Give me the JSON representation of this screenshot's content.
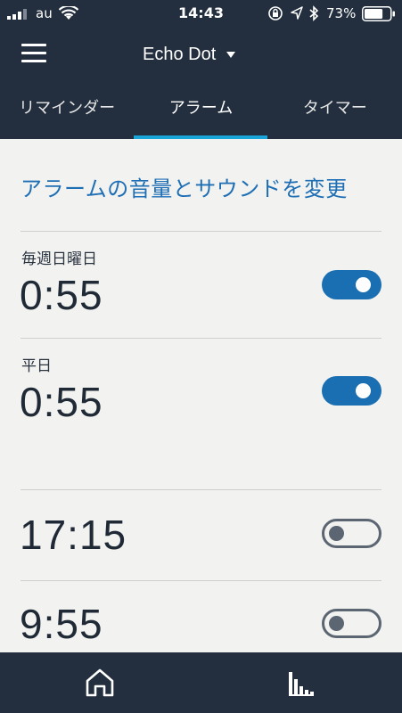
{
  "status_bar": {
    "carrier": "au",
    "time": "14:43",
    "battery_percent": "73%",
    "battery_level": 0.73,
    "icons": [
      "signal-icon",
      "wifi-icon",
      "rotation-lock-icon",
      "location-icon",
      "bluetooth-icon",
      "battery-icon"
    ]
  },
  "header": {
    "menu_icon": "hamburger-menu-icon",
    "device_name": "Echo Dot",
    "caret_icon": "chevron-down-icon"
  },
  "tabs": [
    {
      "label": "リマインダー",
      "active": false
    },
    {
      "label": "アラーム",
      "active": true
    },
    {
      "label": "タイマー",
      "active": false
    }
  ],
  "content": {
    "settings_link": "アラームの音量とサウンドを変更",
    "alarms": [
      {
        "label": "毎週日曜日",
        "time": "0:55",
        "enabled": true
      },
      {
        "label": "平日",
        "time": "0:55",
        "enabled": true
      },
      {
        "label": "",
        "time": "17:15",
        "enabled": false
      },
      {
        "label": "",
        "time": "9:55",
        "enabled": false
      }
    ]
  },
  "bottom_nav": {
    "items": [
      "home-icon",
      "activity-icon"
    ]
  },
  "colors": {
    "header_bg": "#232f3e",
    "accent": "#1aa5d9",
    "toggle_on": "#1a6fb3",
    "link": "#1f6fb5",
    "content_bg": "#f2f2f0"
  }
}
